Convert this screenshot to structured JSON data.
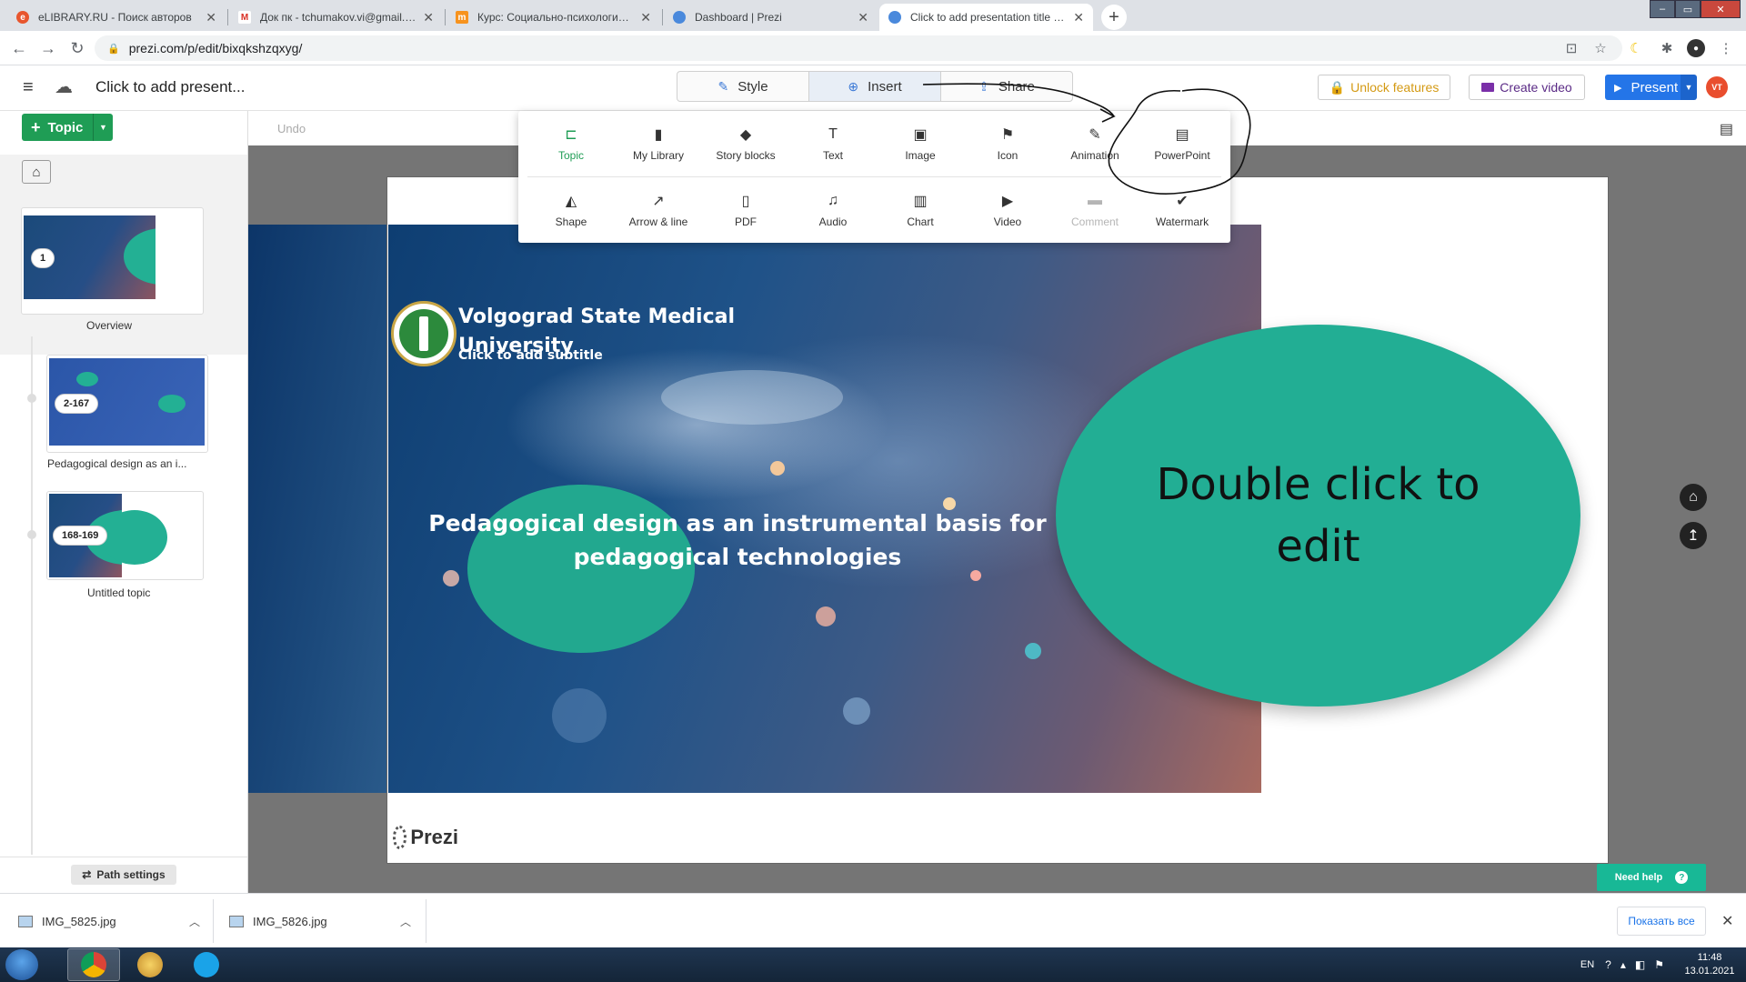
{
  "browser": {
    "tabs": [
      {
        "title": "eLIBRARY.RU - Поиск авторов",
        "favicon": "elibrary-icon",
        "color": "#e8562e"
      },
      {
        "title": "Док пк - tchumakov.vi@gmail.co",
        "favicon": "gmail-icon",
        "color": "#d93025"
      },
      {
        "title": "Курс: Социально-психологичес",
        "favicon": "moodle-icon",
        "color": "#f7931e"
      },
      {
        "title": "Dashboard | Prezi",
        "favicon": "globe-icon",
        "color": "#4a89dc"
      },
      {
        "title": "Click to add presentation title | P",
        "favicon": "globe-icon",
        "color": "#4a89dc"
      }
    ],
    "active_tab_index": 4,
    "url": "prezi.com/p/edit/bixqkshzqxyg/"
  },
  "header": {
    "title": "Click to add present...",
    "tabs": [
      {
        "label": "Style",
        "icon": "magic-wand-icon"
      },
      {
        "label": "Insert",
        "icon": "plus-circle-icon"
      },
      {
        "label": "Share",
        "icon": "share-icon"
      }
    ],
    "active_tab": "Insert",
    "unlock_label": "Unlock features",
    "create_video_label": "Create video",
    "present_label": "Present",
    "avatar_initials": "VT",
    "colors": {
      "present": "#2475e8",
      "unlock": "#d49a14",
      "avatar": "#e94e2e"
    }
  },
  "sidebar": {
    "add_topic_label": "Topic",
    "thumbnails": [
      {
        "number": "1",
        "label": "Overview"
      },
      {
        "number": "2-167",
        "label": "Pedagogical design as an i..."
      },
      {
        "number": "168-169",
        "label": "Untitled topic"
      }
    ],
    "path_settings_label": "Path settings"
  },
  "canvas": {
    "undo_label": "Undo",
    "university": "Volgograd State Medical University",
    "subtitle": "Click to add subtitle",
    "main_title": "Pedagogical design as an instrumental basis for pedagogical technologies",
    "bubble_text": "Double click to edit",
    "brand": "Prezi",
    "help_label": "Need help",
    "colors": {
      "teal": "#22ae94",
      "help": "#18b896"
    }
  },
  "insert_menu": {
    "row1": [
      {
        "label": "Topic",
        "icon": "topic-icon",
        "selected": true
      },
      {
        "label": "My Library",
        "icon": "library-icon"
      },
      {
        "label": "Story blocks",
        "icon": "layers-icon"
      },
      {
        "label": "Text",
        "icon": "text-icon"
      },
      {
        "label": "Image",
        "icon": "image-icon"
      },
      {
        "label": "Icon",
        "icon": "flag-icon"
      },
      {
        "label": "Animation",
        "icon": "animation-icon"
      },
      {
        "label": "PowerPoint",
        "icon": "powerpoint-icon"
      }
    ],
    "row2": [
      {
        "label": "Shape",
        "icon": "shape-icon"
      },
      {
        "label": "Arrow & line",
        "icon": "arrow-icon"
      },
      {
        "label": "PDF",
        "icon": "pdf-icon"
      },
      {
        "label": "Audio",
        "icon": "music-icon"
      },
      {
        "label": "Chart",
        "icon": "chart-icon"
      },
      {
        "label": "Video",
        "icon": "video-icon"
      },
      {
        "label": "Comment",
        "icon": "comment-icon",
        "disabled": true
      },
      {
        "label": "Watermark",
        "icon": "watermark-icon"
      }
    ]
  },
  "downloads": {
    "items": [
      {
        "name": "IMG_5825.jpg"
      },
      {
        "name": "IMG_5826.jpg"
      }
    ],
    "show_all_label": "Показать все"
  },
  "taskbar": {
    "language": "EN",
    "time": "11:48",
    "date": "13.01.2021"
  }
}
